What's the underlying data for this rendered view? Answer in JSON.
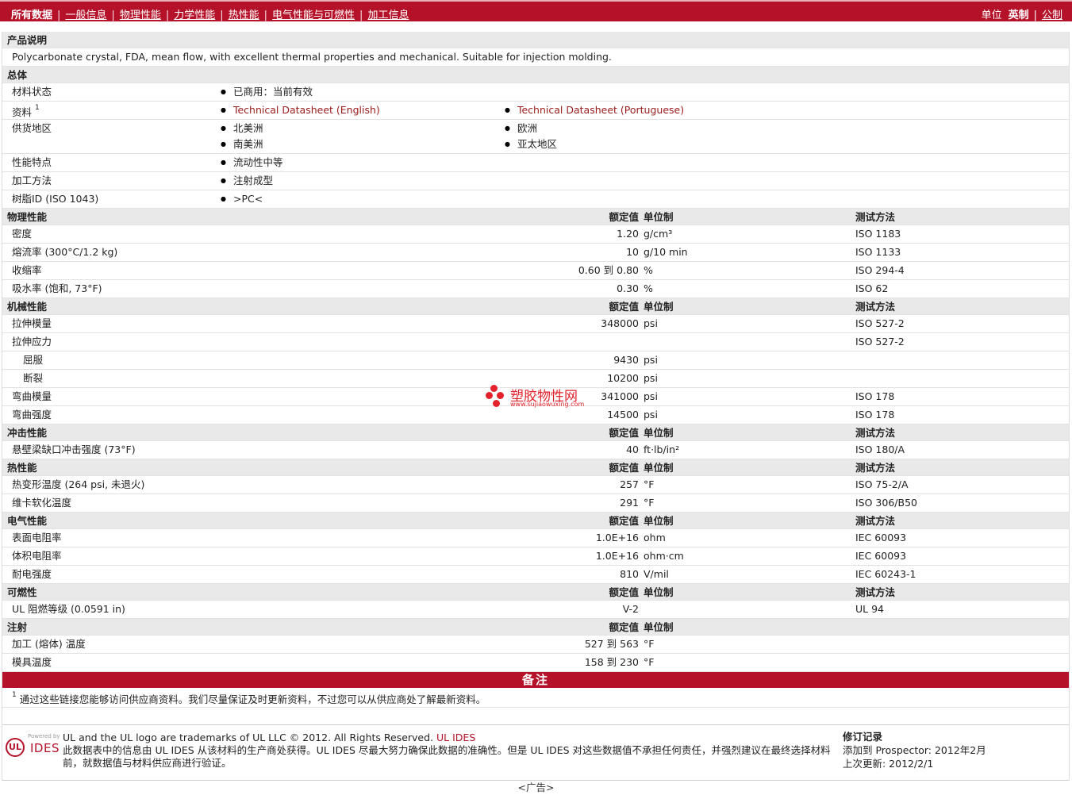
{
  "nav": {
    "all": "所有数据",
    "items": [
      "一般信息",
      "物理性能",
      "力学性能",
      "热性能",
      "电气性能与可燃性",
      "加工信息"
    ],
    "units_label": "单位",
    "units_selected": "英制",
    "units_other": "公制"
  },
  "desc": {
    "title": "产品说明",
    "text": "Polycarbonate crystal, FDA, mean flow, with excellent thermal properties and mechanical. Suitable for injection molding."
  },
  "general": {
    "title": "总体",
    "status_label": "材料状态",
    "status_value": "已商用：当前有效",
    "docs_label": "资料",
    "docs_sup": "1",
    "doc1": "Technical Datasheet (English)",
    "doc2": "Technical Datasheet (Portuguese)",
    "supply_label": "供货地区",
    "regions": [
      "北美洲",
      "欧洲",
      "南美洲",
      "亚太地区"
    ],
    "features_label": "性能特点",
    "features_value": "流动性中等",
    "process_label": "加工方法",
    "process_value": "注射成型",
    "resin_label": "树脂ID (ISO 1043)",
    "resin_value": ">PC<"
  },
  "headers": {
    "nominal": "额定值",
    "unit": "单位制",
    "test": "测试方法"
  },
  "sections": {
    "physical": {
      "title": "物理性能",
      "rows": [
        {
          "label": "密度",
          "nominal": "1.20",
          "unit": "g/cm³",
          "test": "ISO 1183"
        },
        {
          "label": "熔流率 (300°C/1.2 kg)",
          "nominal": "10",
          "unit": "g/10 min",
          "test": "ISO 1133"
        },
        {
          "label": "收缩率",
          "nominal": "0.60 到  0.80",
          "unit": "%",
          "test": "ISO 294-4"
        },
        {
          "label": "吸水率 (饱和, 73°F)",
          "nominal": "0.30",
          "unit": "%",
          "test": "ISO 62"
        }
      ]
    },
    "mechanical": {
      "title": "机械性能",
      "rows": [
        {
          "label": "拉伸模量",
          "nominal": "348000",
          "unit": "psi",
          "test": "ISO 527-2"
        },
        {
          "label": "拉伸应力",
          "nominal": "",
          "unit": "",
          "test": "ISO 527-2"
        },
        {
          "label": "屈服",
          "nominal": "9430",
          "unit": "psi",
          "test": ""
        },
        {
          "label": "断裂",
          "nominal": "10200",
          "unit": "psi",
          "test": ""
        },
        {
          "label": "弯曲模量",
          "nominal": "341000",
          "unit": "psi",
          "test": "ISO 178"
        },
        {
          "label": "弯曲强度",
          "nominal": "14500",
          "unit": "psi",
          "test": "ISO 178"
        }
      ]
    },
    "impact": {
      "title": "冲击性能",
      "rows": [
        {
          "label": "悬壁梁缺口冲击强度 (73°F)",
          "nominal": "40",
          "unit": "ft·lb/in²",
          "test": "ISO 180/A"
        }
      ]
    },
    "thermal": {
      "title": "热性能",
      "rows": [
        {
          "label": "热变形温度 (264 psi, 未退火)",
          "nominal": "257",
          "unit": "°F",
          "test": "ISO 75-2/A"
        },
        {
          "label": "维卡软化温度",
          "nominal": "291",
          "unit": "°F",
          "test": "ISO 306/B50"
        }
      ]
    },
    "electrical": {
      "title": "电气性能",
      "rows": [
        {
          "label": "表面电阻率",
          "nominal": "1.0E+16",
          "unit": "ohm",
          "test": "IEC 60093"
        },
        {
          "label": "体积电阻率",
          "nominal": "1.0E+16",
          "unit": "ohm·cm",
          "test": "IEC 60093"
        },
        {
          "label": "耐电强度",
          "nominal": "810",
          "unit": "V/mil",
          "test": "IEC 60243-1"
        }
      ]
    },
    "flammability": {
      "title": "可燃性",
      "rows": [
        {
          "label": "UL 阻燃等级 (0.0591 in)",
          "nominal": "V-2",
          "unit": "",
          "test": "UL 94"
        }
      ]
    },
    "injection": {
      "title": "注射",
      "rows": [
        {
          "label": "加工 (熔体) 温度",
          "nominal": "527 到  563",
          "unit": "°F",
          "test": ""
        },
        {
          "label": "模具温度",
          "nominal": "158 到  230",
          "unit": "°F",
          "test": ""
        }
      ]
    }
  },
  "notes": {
    "title": "备注",
    "sup": "1",
    "text": "通过这些链接您能够访问供应商资料。我们尽量保证及时更新资料，不过您可以从供应商处了解最新资料。"
  },
  "footer": {
    "powered": "Powered by",
    "ul_mark": "UL",
    "ides": "IDES",
    "line1": "UL and the UL logo are trademarks of UL LLC © 2012. All Rights Reserved.",
    "line1_link": "UL IDES",
    "line2": "此数据表中的信息由  UL IDES 从该材料的生产商处获得。UL IDES 尽最大努力确保此数据的准确性。但是  UL IDES 对这些数据值不承担任何责任，并强烈建议在最终选择材料前，就数据值与材料供应商进行验证。",
    "rev_title": "修订记录",
    "rev_added": "添加到  Prospector:    2012年2月",
    "rev_updated": "上次更新:    2012/2/1"
  },
  "ad": "<广告>",
  "watermark": {
    "cn": "塑胶物性网",
    "url": "www.sujiaowuxing.com"
  },
  "colors": {
    "brand": "#b5122a",
    "link": "#9b1b1b",
    "section_bg": "#e9e9e9"
  }
}
